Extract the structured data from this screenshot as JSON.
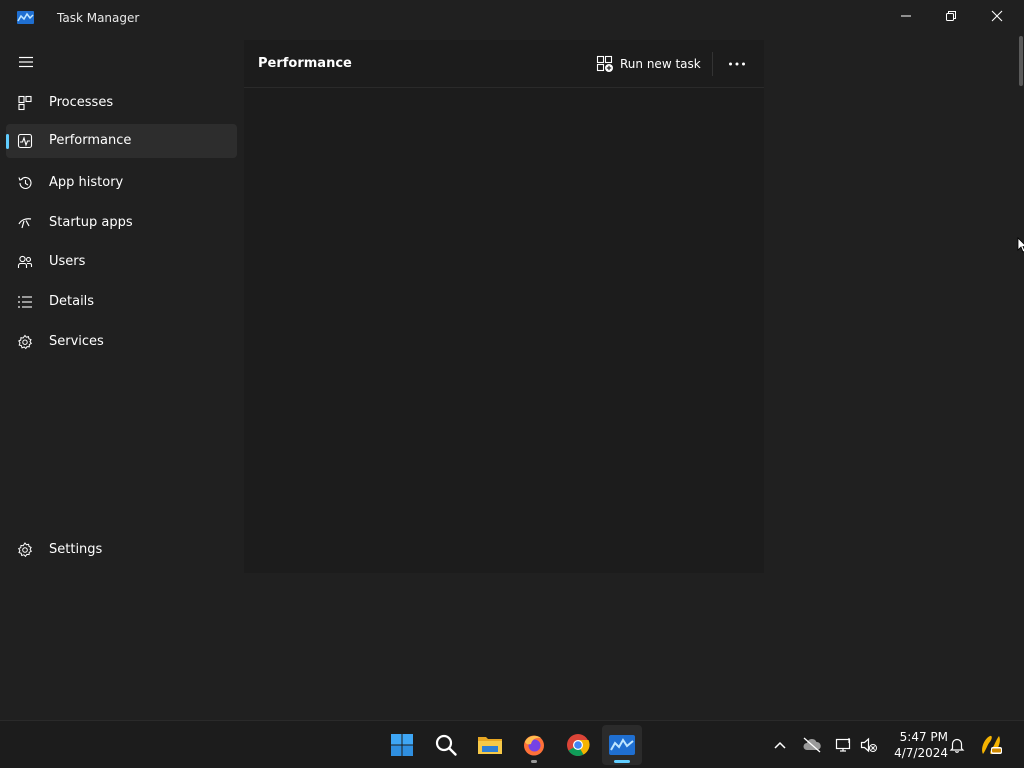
{
  "window": {
    "title": "Task Manager"
  },
  "nav": {
    "items": [
      {
        "label": "Processes",
        "icon": "processes-icon"
      },
      {
        "label": "Performance",
        "icon": "performance-icon",
        "active": true
      },
      {
        "label": "App history",
        "icon": "app-history-icon"
      },
      {
        "label": "Startup apps",
        "icon": "startup-apps-icon"
      },
      {
        "label": "Users",
        "icon": "users-icon"
      },
      {
        "label": "Details",
        "icon": "details-icon"
      },
      {
        "label": "Services",
        "icon": "services-icon"
      }
    ],
    "settings_label": "Settings"
  },
  "panel": {
    "title": "Performance",
    "run_new_task_label": "Run new task"
  },
  "taskbar": {
    "apps": [
      "start-icon",
      "search-icon",
      "file-explorer-icon",
      "firefox-icon",
      "chrome-icon",
      "task-manager-icon"
    ],
    "clock": {
      "time": "5:47 PM",
      "date": "4/7/2024"
    }
  },
  "colors": {
    "accent": "#60cdff",
    "background": "#202020",
    "panel": "#1c1c1c",
    "active_item": "#2d2d2d"
  }
}
